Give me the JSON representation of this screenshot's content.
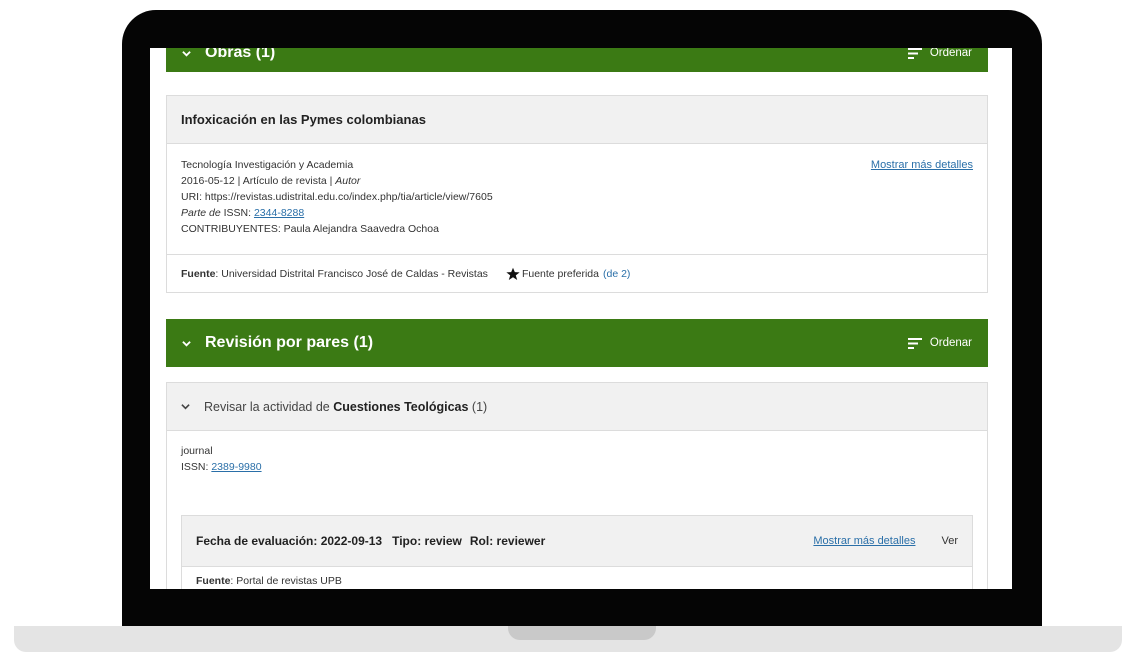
{
  "works_section": {
    "title": "Obras (1)",
    "sort_label": "Ordenar"
  },
  "work_card": {
    "title": "Infoxicación en las Pymes colombianas",
    "journal": "Tecnología Investigación y Academia",
    "meta_prefix": "2016-05-12 | Artículo de revista | ",
    "meta_role": "Autor",
    "uri": "URI: https://revistas.udistrital.edu.co/index.php/tia/article/view/7605",
    "part_of_label": "Parte de",
    "issn_label": " ISSN: ",
    "issn_value": "2344-8288",
    "contributors": "CONTRIBUYENTES: Paula Alejandra Saavedra Ochoa",
    "more_details": "Mostrar más detalles",
    "source_label": "Fuente",
    "source_value": ": Universidad Distrital Francisco José de Caldas - Revistas",
    "preferred_label": "Fuente preferida",
    "preferred_count": "(de 2)"
  },
  "review_section": {
    "title": "Revisión por pares (1)",
    "sort_label": "Ordenar"
  },
  "review_group": {
    "prefix": "Revisar la actividad de ",
    "journal_name": "Cuestiones Teológicas",
    "count": " (1)",
    "type": "journal",
    "issn_label": "ISSN: ",
    "issn_value": "2389-9980"
  },
  "review_item": {
    "date_label": "Fecha de evaluación: 2022-09-13",
    "type_label": "Tipo: review",
    "role_label": "Rol: reviewer",
    "more_details": "Mostrar más detalles",
    "view_label": "Ver",
    "source_label": "Fuente",
    "source_value": ": Portal de revistas UPB"
  },
  "colors": {
    "section_header": "#3b7a14",
    "link": "#2a6fa8",
    "card_head_bg": "#f1f1f1"
  }
}
